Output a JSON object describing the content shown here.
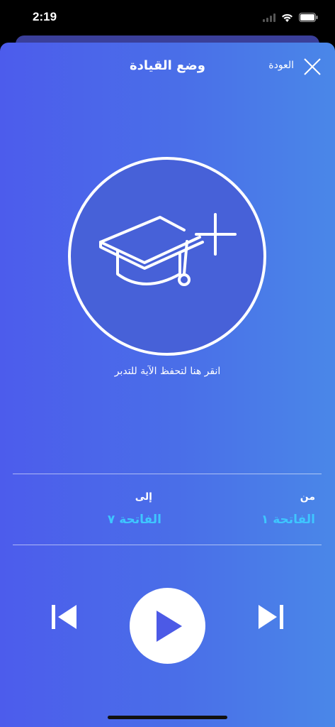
{
  "status": {
    "time": "2:19"
  },
  "header": {
    "title": "وضع القيادة",
    "back_label": "العودة"
  },
  "memorize": {
    "hint": "انقر هنا لتحفظ الآية للتدبر"
  },
  "range": {
    "from_label": "من",
    "from_value": "الفاتحة ١",
    "to_label": "إلى",
    "to_value": "الفاتحة ٧"
  },
  "colors": {
    "gradient_start": "#4c5cec",
    "gradient_end": "#4a87e8",
    "accent": "#3ec6ff"
  },
  "icons": {
    "close": "close-icon",
    "memorize": "graduation-cap-plus-icon",
    "previous": "skip-previous-icon",
    "play": "play-icon",
    "next": "skip-next-icon"
  }
}
